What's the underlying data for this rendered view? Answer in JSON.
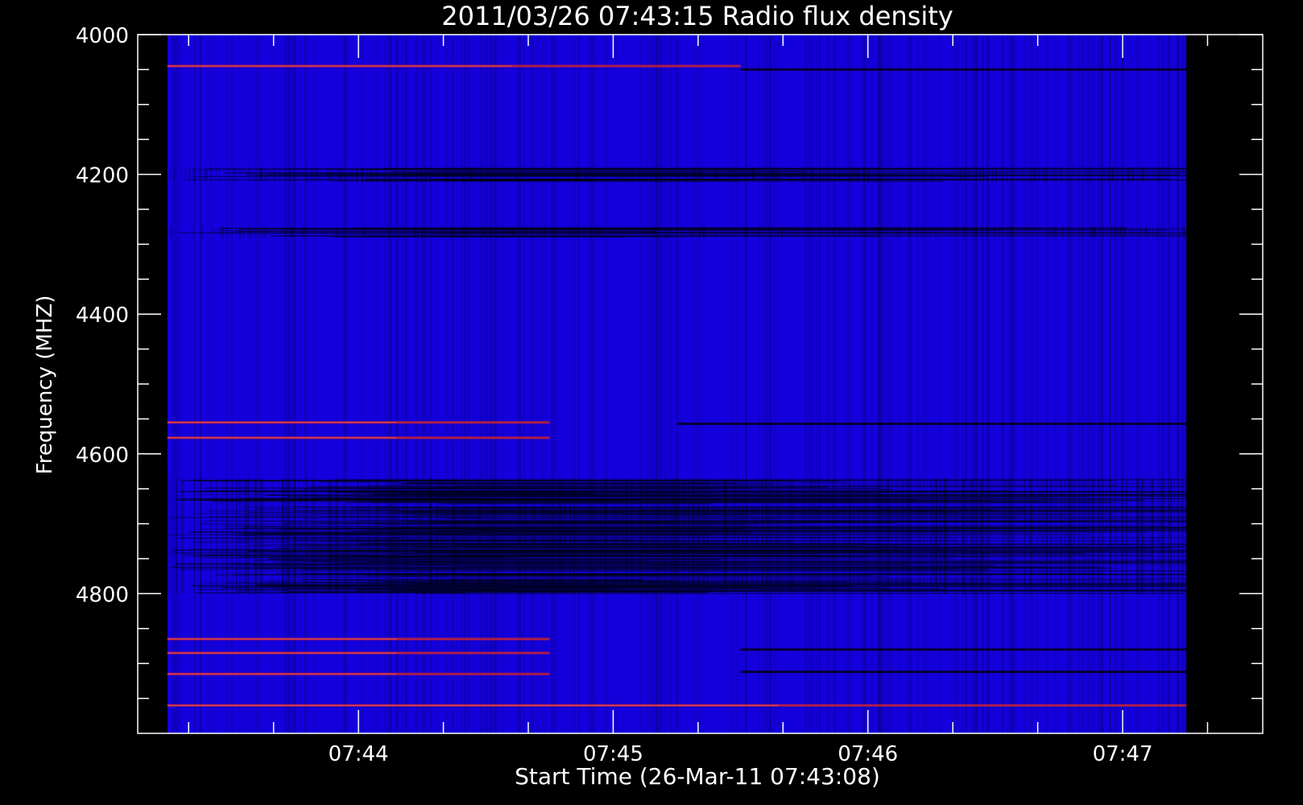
{
  "chart_data": {
    "type": "heatmap",
    "title": "2011/03/26 07:43:15 Radio flux density",
    "xlabel": "Start Time (26-Mar-11 07:43:08)",
    "ylabel": "Frequency (MHZ)",
    "x_unit": "time",
    "xlim": [
      "07:43:08",
      "07:47:33"
    ],
    "ylim": [
      4000,
      5000
    ],
    "y_inverted": true,
    "x_ticks": [
      "07:44",
      "07:45",
      "07:46",
      "07:47"
    ],
    "y_ticks": [
      4000,
      4200,
      4400,
      4600,
      4800
    ],
    "data_time_range": [
      "07:43:15",
      "07:47:15"
    ],
    "data_freq_range": [
      4000,
      5000
    ],
    "colormap": {
      "background": "#1400dc",
      "bright": "#c0203a",
      "dark": "#0a0040"
    },
    "bright_bands": [
      {
        "freq": 4045,
        "time_from": "07:43:15",
        "time_to": "07:45:30"
      },
      {
        "freq": 4555,
        "time_from": "07:43:15",
        "time_to": "07:44:45"
      },
      {
        "freq": 4577,
        "time_from": "07:43:15",
        "time_to": "07:44:45"
      },
      {
        "freq": 4865,
        "time_from": "07:43:15",
        "time_to": "07:44:45"
      },
      {
        "freq": 4885,
        "time_from": "07:43:15",
        "time_to": "07:44:45"
      },
      {
        "freq": 4915,
        "time_from": "07:43:15",
        "time_to": "07:44:45"
      },
      {
        "freq": 4960,
        "time_from": "07:43:15",
        "time_to": "07:47:15"
      }
    ],
    "dark_bands": [
      {
        "freq": 4050,
        "time_from": "07:45:30",
        "time_to": "07:47:15"
      },
      {
        "freq": 4557,
        "time_from": "07:45:15",
        "time_to": "07:47:15"
      },
      {
        "freq": 4880,
        "time_from": "07:45:30",
        "time_to": "07:47:15"
      },
      {
        "freq": 4912,
        "time_from": "07:45:30",
        "time_to": "07:47:15"
      }
    ],
    "noisy_regions": [
      {
        "freq_from": 4635,
        "freq_to": 4800,
        "time_from": "07:43:15",
        "time_to": "07:47:15"
      },
      {
        "freq_from": 4190,
        "freq_to": 4210,
        "time_from": "07:43:15",
        "time_to": "07:47:15"
      },
      {
        "freq_from": 4275,
        "freq_to": 4290,
        "time_from": "07:43:15",
        "time_to": "07:47:15"
      }
    ]
  }
}
